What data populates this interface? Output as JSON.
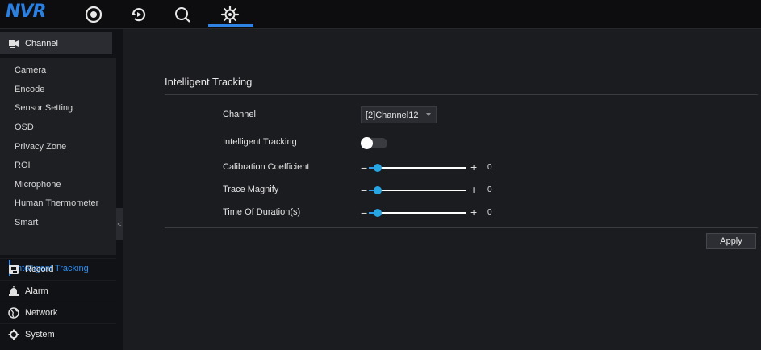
{
  "app": {
    "logo": "NVR"
  },
  "topnav": {
    "items": [
      {
        "icon": "live-view-icon"
      },
      {
        "icon": "playback-icon"
      },
      {
        "icon": "search-icon"
      },
      {
        "icon": "settings-gear-icon",
        "active": true
      }
    ]
  },
  "sidebar": {
    "channel": {
      "label": "Channel",
      "icon": "channel-camera-icon"
    },
    "subitems": [
      "Camera",
      "Encode",
      "Sensor Setting",
      "OSD",
      "Privacy Zone",
      "ROI",
      "Microphone",
      "Human Thermometer",
      "Smart",
      "Intelligent Tracking"
    ],
    "active_subitem": "Intelligent Tracking",
    "groups": [
      {
        "label": "Record",
        "icon": "record-icon"
      },
      {
        "label": "Alarm",
        "icon": "alarm-icon"
      },
      {
        "label": "Network",
        "icon": "network-globe-icon"
      },
      {
        "label": "System",
        "icon": "system-gear-icon"
      }
    ],
    "collapse_glyph": "<"
  },
  "content": {
    "title": "Intelligent Tracking",
    "channel_label": "Channel",
    "channel_value": "[2]Channel12",
    "tracking_label": "Intelligent Tracking",
    "tracking_enabled": false,
    "sliders": [
      {
        "label": "Calibration Coefficient",
        "value": "0",
        "minus": "−",
        "plus": "+"
      },
      {
        "label": "Trace Magnify",
        "value": "0",
        "minus": "−",
        "plus": "+"
      },
      {
        "label": "Time Of Duration(s)",
        "value": "0",
        "minus": "−",
        "plus": "+"
      }
    ],
    "apply_label": "Apply"
  },
  "colors": {
    "accent": "#2f8ef0",
    "slider_thumb": "#27a6e6",
    "background": "#1b1c20",
    "sidebar": "#111215"
  }
}
